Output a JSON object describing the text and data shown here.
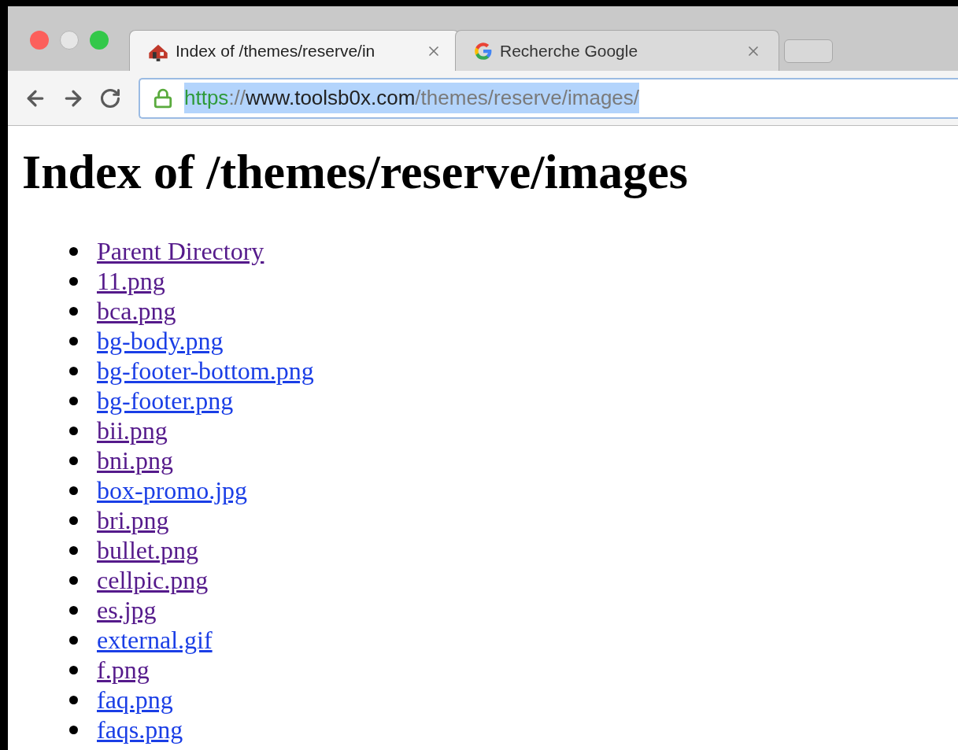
{
  "window": {
    "tabs": [
      {
        "title": "Index of /themes/reserve/in",
        "selected": true,
        "kind": "site"
      },
      {
        "title": "Recherche Google",
        "selected": false,
        "kind": "google"
      }
    ],
    "address_bar": {
      "selected": true,
      "parts": [
        {
          "text": "https",
          "kind": "scheme"
        },
        {
          "text": "://",
          "kind": "dim"
        },
        {
          "text": "www.toolsb0x.com",
          "kind": "host"
        },
        {
          "text": "/themes/reserve/images/",
          "kind": "dim"
        }
      ]
    }
  },
  "page": {
    "heading": "Index of /themes/reserve/images",
    "links": [
      {
        "text": "Parent Directory",
        "visited": true
      },
      {
        "text": "11.png",
        "visited": true
      },
      {
        "text": "bca.png",
        "visited": true
      },
      {
        "text": "bg-body.png",
        "visited": false
      },
      {
        "text": "bg-footer-bottom.png",
        "visited": false
      },
      {
        "text": "bg-footer.png",
        "visited": false
      },
      {
        "text": "bii.png",
        "visited": true
      },
      {
        "text": "bni.png",
        "visited": true
      },
      {
        "text": "box-promo.jpg",
        "visited": false
      },
      {
        "text": "bri.png",
        "visited": true
      },
      {
        "text": "bullet.png",
        "visited": true
      },
      {
        "text": "cellpic.png",
        "visited": true
      },
      {
        "text": "es.jpg",
        "visited": true
      },
      {
        "text": "external.gif",
        "visited": false
      },
      {
        "text": "f.png",
        "visited": true
      },
      {
        "text": "faq.png",
        "visited": false
      },
      {
        "text": "faqs.png",
        "visited": false
      }
    ]
  }
}
